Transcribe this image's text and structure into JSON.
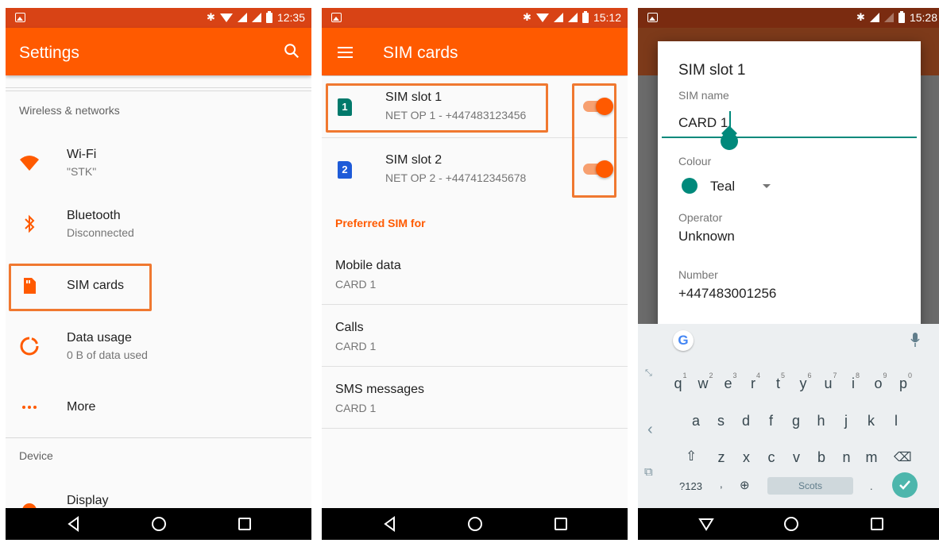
{
  "panel1": {
    "status_time": "12:35",
    "title": "Settings",
    "section_wireless": "Wireless & networks",
    "section_device": "Device",
    "items": [
      {
        "label": "Wi-Fi",
        "sub": "\"STK\"",
        "icon": "wifi-icon"
      },
      {
        "label": "Bluetooth",
        "sub": "Disconnected",
        "icon": "bluetooth-icon"
      },
      {
        "label": "SIM cards",
        "sub": "",
        "icon": "sim-card-icon"
      },
      {
        "label": "Data usage",
        "sub": "0 B of data used",
        "icon": "data-usage-icon"
      },
      {
        "label": "More",
        "sub": "",
        "icon": "more-dots-icon"
      },
      {
        "label": "Display",
        "sub": "",
        "icon": "display-icon"
      }
    ],
    "accent": "#ff5a00"
  },
  "panel2": {
    "status_time": "15:12",
    "title": "SIM cards",
    "sims": [
      {
        "slot": "1",
        "label": "SIM slot 1",
        "sub": "NET OP 1 - +447483123456",
        "color": "#00796b",
        "enabled": true
      },
      {
        "slot": "2",
        "label": "SIM slot 2",
        "sub": "NET OP 2 - +447412345678",
        "color": "#1e5bd8",
        "enabled": true
      }
    ],
    "preferred_header": "Preferred SIM for",
    "preferred": [
      {
        "label": "Mobile data",
        "value": "CARD 1"
      },
      {
        "label": "Calls",
        "value": "CARD 1"
      },
      {
        "label": "SMS messages",
        "value": "CARD 1"
      }
    ]
  },
  "panel3": {
    "status_time": "15:28",
    "dialog_title": "SIM slot 1",
    "sim_name_label": "SIM name",
    "sim_name_value": "CARD 1",
    "colour_label": "Colour",
    "colour_value": "Teal",
    "operator_label": "Operator",
    "operator_value": "Unknown",
    "number_label": "Number",
    "number_value": "+447483001256",
    "keyboard": {
      "row1": [
        "q",
        "w",
        "e",
        "r",
        "t",
        "y",
        "u",
        "i",
        "o",
        "p"
      ],
      "row1_nums": [
        "1",
        "2",
        "3",
        "4",
        "5",
        "6",
        "7",
        "8",
        "9",
        "0"
      ],
      "row2": [
        "a",
        "s",
        "d",
        "f",
        "g",
        "h",
        "j",
        "k",
        "l"
      ],
      "row3": [
        "z",
        "x",
        "c",
        "v",
        "b",
        "n",
        "m"
      ],
      "symbols_key": "?123",
      "comma_key": ",",
      "period_key": ".",
      "space_label": "Scots"
    },
    "accent": "#00897b"
  }
}
